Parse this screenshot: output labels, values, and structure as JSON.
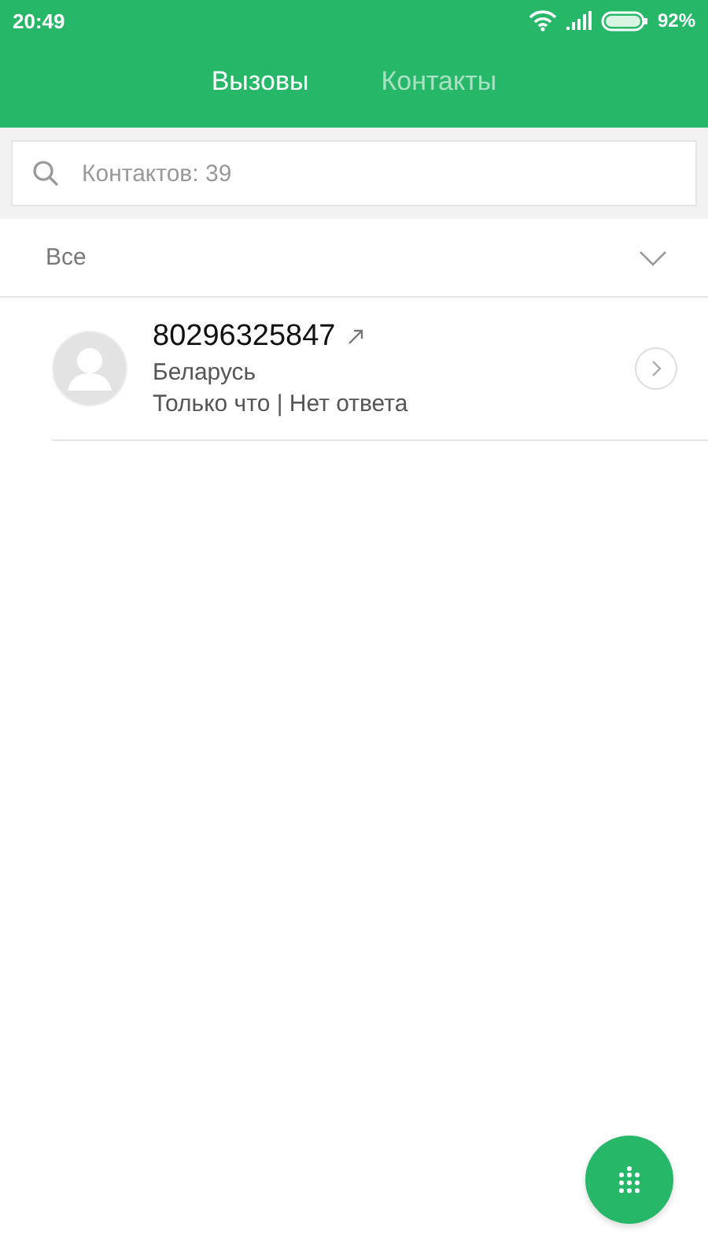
{
  "status_bar": {
    "time": "20:49",
    "battery": "92%"
  },
  "tabs": [
    {
      "label": "Вызовы",
      "selected": true
    },
    {
      "label": "Контакты",
      "selected": false
    }
  ],
  "search": {
    "placeholder": "Контактов: 39"
  },
  "filter": {
    "label": "Все"
  },
  "calls": [
    {
      "number": "80296325847",
      "location": "Беларусь",
      "details": "Только что | Нет ответа"
    }
  ]
}
